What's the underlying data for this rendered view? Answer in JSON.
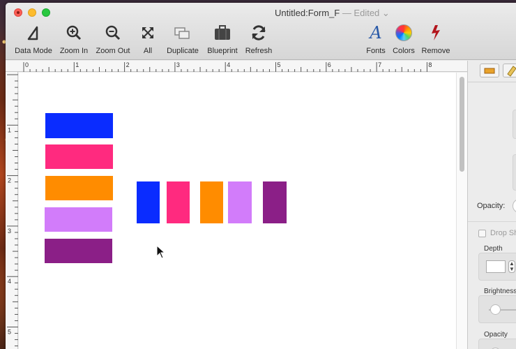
{
  "window": {
    "title": "Untitled:Form_F",
    "edited": " — Edited ⌄"
  },
  "toolbar": {
    "items": [
      {
        "label": "Data Mode",
        "icon": "data-mode-icon"
      },
      {
        "label": "Zoom In",
        "icon": "zoom-in-icon"
      },
      {
        "label": "Zoom Out",
        "icon": "zoom-out-icon"
      },
      {
        "label": "All",
        "icon": "fit-all-icon"
      },
      {
        "label": "Duplicate",
        "icon": "duplicate-icon"
      },
      {
        "label": "Blueprint",
        "icon": "blueprint-icon"
      },
      {
        "label": "Refresh",
        "icon": "refresh-icon"
      },
      {
        "label": "Fonts",
        "icon": "fonts-icon"
      },
      {
        "label": "Colors",
        "icon": "colors-icon"
      },
      {
        "label": "Remove",
        "icon": "remove-icon"
      }
    ]
  },
  "ruler": {
    "h_numbers": [
      "0",
      "1",
      "2",
      "3",
      "4",
      "5",
      "6",
      "7",
      "8"
    ],
    "v_numbers": [
      "1",
      "2",
      "3",
      "4",
      "5"
    ]
  },
  "shapes": {
    "stack_colors": [
      "#0a2cff",
      "#ff2a7f",
      "#ff8c00",
      "#d27cfa",
      "#8b1f87"
    ],
    "row_colors": [
      "#0a2cff",
      "#ff2a7f",
      "#ff8c00",
      "#d27cfa",
      "#8b1f87"
    ]
  },
  "inspector": {
    "opacity_label": "Opacity:",
    "drop_shadow_label": "Drop Sha",
    "depth_label": "Depth",
    "brightness_label": "Brightness",
    "opacity2_label": "Opacity",
    "cut_s": "S",
    "cut_d": "D"
  }
}
